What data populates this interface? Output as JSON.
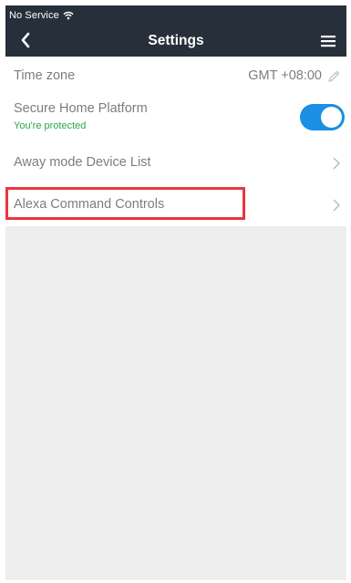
{
  "status_bar": {
    "carrier": "No Service",
    "wifi_icon": "wifi-icon"
  },
  "nav": {
    "back_icon": "chevron-left-icon",
    "title": "Settings",
    "menu_icon": "hamburger-menu-icon"
  },
  "settings": {
    "time_zone": {
      "label": "Time zone",
      "value": "GMT +08:00",
      "edit_icon": "pencil-icon"
    },
    "secure_home": {
      "label": "Secure Home Platform",
      "status": "You're protected",
      "toggle_on": true
    },
    "away_mode": {
      "label": "Away mode Device List",
      "icon": "chevron-right-icon"
    },
    "alexa": {
      "label": "Alexa Command Controls",
      "icon": "chevron-right-icon",
      "highlighted": true
    }
  },
  "colors": {
    "header_bg": "#27303a",
    "toggle_on": "#1a8fe3",
    "status_green": "#2aa84a",
    "highlight": "#e8373f",
    "background": "#eeeeee"
  }
}
